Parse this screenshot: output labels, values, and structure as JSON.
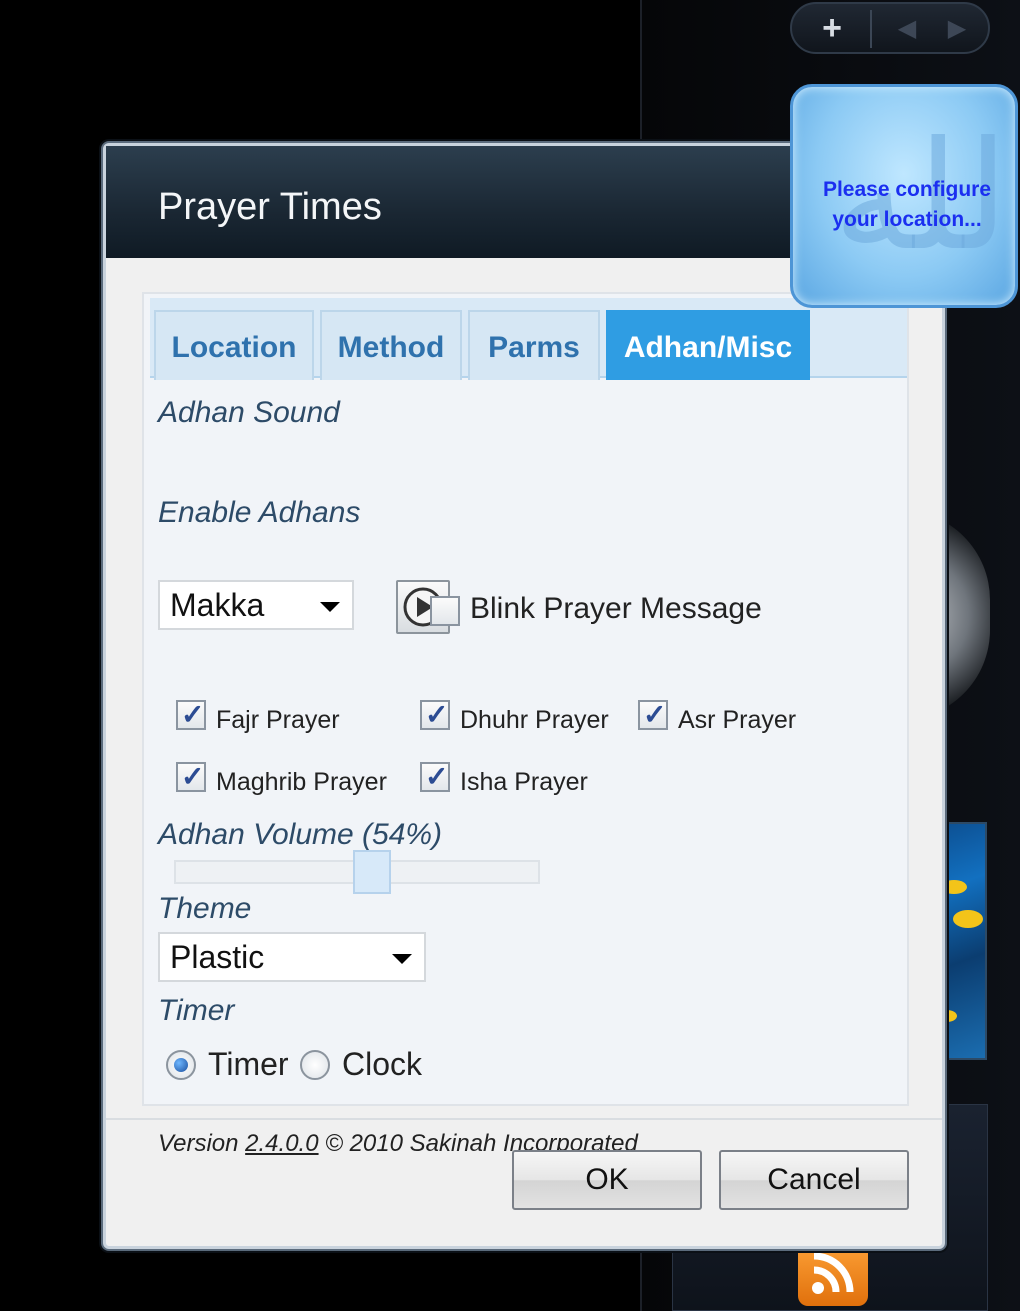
{
  "dialog": {
    "title": "Prayer Times"
  },
  "tabs": [
    {
      "label": "Location",
      "active": false
    },
    {
      "label": "Method",
      "active": false
    },
    {
      "label": "Parms",
      "active": false
    },
    {
      "label": "Adhan/Misc",
      "active": true
    }
  ],
  "adhan_sound": {
    "label": "Adhan Sound",
    "selected": "Makka",
    "play_icon": "play-icon",
    "blink_checkbox": {
      "label": "Blink Prayer Message",
      "checked": false
    }
  },
  "enable_adhans": {
    "label": "Enable Adhans",
    "items": [
      {
        "label": "Fajr Prayer",
        "checked": true
      },
      {
        "label": "Dhuhr Prayer",
        "checked": true
      },
      {
        "label": "Asr Prayer",
        "checked": true
      },
      {
        "label": "Maghrib Prayer",
        "checked": true
      },
      {
        "label": "Isha Prayer",
        "checked": true
      }
    ]
  },
  "volume": {
    "label": "Adhan Volume (54%)",
    "value_percent": 54
  },
  "theme": {
    "label": "Theme",
    "selected": "Plastic"
  },
  "timer": {
    "label": "Timer",
    "options": [
      {
        "label": "Timer",
        "selected": true
      },
      {
        "label": "Clock",
        "selected": false
      }
    ]
  },
  "footer": {
    "version_prefix": "Version",
    "version_number": "2.4.0.0",
    "copyright": "© 2010 Sakinah Incorporated"
  },
  "buttons": {
    "ok": "OK",
    "cancel": "Cancel"
  },
  "gadget": {
    "message": "Please configure your location...",
    "calligraphy": "الله"
  },
  "sidebar": {
    "add_icon": "plus-icon",
    "prev_icon": "chevron-left-icon",
    "next_icon": "chevron-right-icon"
  },
  "colors": {
    "active_tab": "#2f9de3",
    "tab_text": "#2f72ad",
    "gadget_text": "#1b2ff0"
  }
}
